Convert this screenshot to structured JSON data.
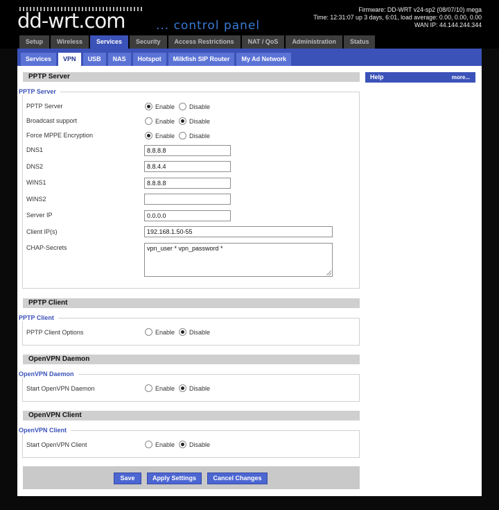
{
  "header": {
    "logo": "dd-wrt.com",
    "subtitle": "... control panel",
    "firmware": "Firmware: DD-WRT v24-sp2 (08/07/10) mega",
    "time": "Time: 12:31:07 up 3 days, 6:01, load average: 0.00, 0.00, 0.00",
    "wan_ip": "WAN IP: 44.144.244.344"
  },
  "main_tabs": [
    "Setup",
    "Wireless",
    "Services",
    "Security",
    "Access Restrictions",
    "NAT / QoS",
    "Administration",
    "Status"
  ],
  "sub_tabs": [
    "Services",
    "VPN",
    "USB",
    "NAS",
    "Hotspot",
    "Milkfish SIP Router",
    "My Ad Network"
  ],
  "radio": {
    "enable": "Enable",
    "disable": "Disable"
  },
  "pptp_server": {
    "section_title": "PPTP Server",
    "legend": "PPTP Server",
    "labels": {
      "server": "PPTP Server",
      "broadcast": "Broadcast support",
      "mppe": "Force MPPE Encryption",
      "dns1": "DNS1",
      "dns2": "DNS2",
      "wins1": "WINS1",
      "wins2": "WINS2",
      "server_ip": "Server IP",
      "client_ips": "Client IP(s)",
      "chap": "CHAP-Secrets"
    },
    "values": {
      "dns1": "8.8.8.8",
      "dns2": "8.8.4.4",
      "wins1": "8.8.8.8",
      "wins2": "",
      "server_ip": "0.0.0.0",
      "client_ips": "192.168.1.50-55",
      "chap": "vpn_user * vpn_password *"
    },
    "state": {
      "server": "Enable",
      "broadcast": "Disable",
      "mppe": "Enable"
    }
  },
  "pptp_client": {
    "section_title": "PPTP Client",
    "legend": "PPTP Client",
    "label": "PPTP Client Options",
    "state": "Disable"
  },
  "openvpn_daemon": {
    "section_title": "OpenVPN Daemon",
    "legend": "OpenVPN Daemon",
    "label": "Start OpenVPN Daemon",
    "state": "Disable"
  },
  "openvpn_client": {
    "section_title": "OpenVPN Client",
    "legend": "OpenVPN Client",
    "label": "Start OpenVPN Client",
    "state": "Disable"
  },
  "help": {
    "title": "Help",
    "more": "more..."
  },
  "buttons": {
    "save": "Save",
    "apply": "Apply Settings",
    "cancel": "Cancel Changes"
  },
  "colors": {
    "accent": "#3b52b8",
    "tab_inactive": "#3d3d3d",
    "section_bar": "#cfcfcf"
  }
}
